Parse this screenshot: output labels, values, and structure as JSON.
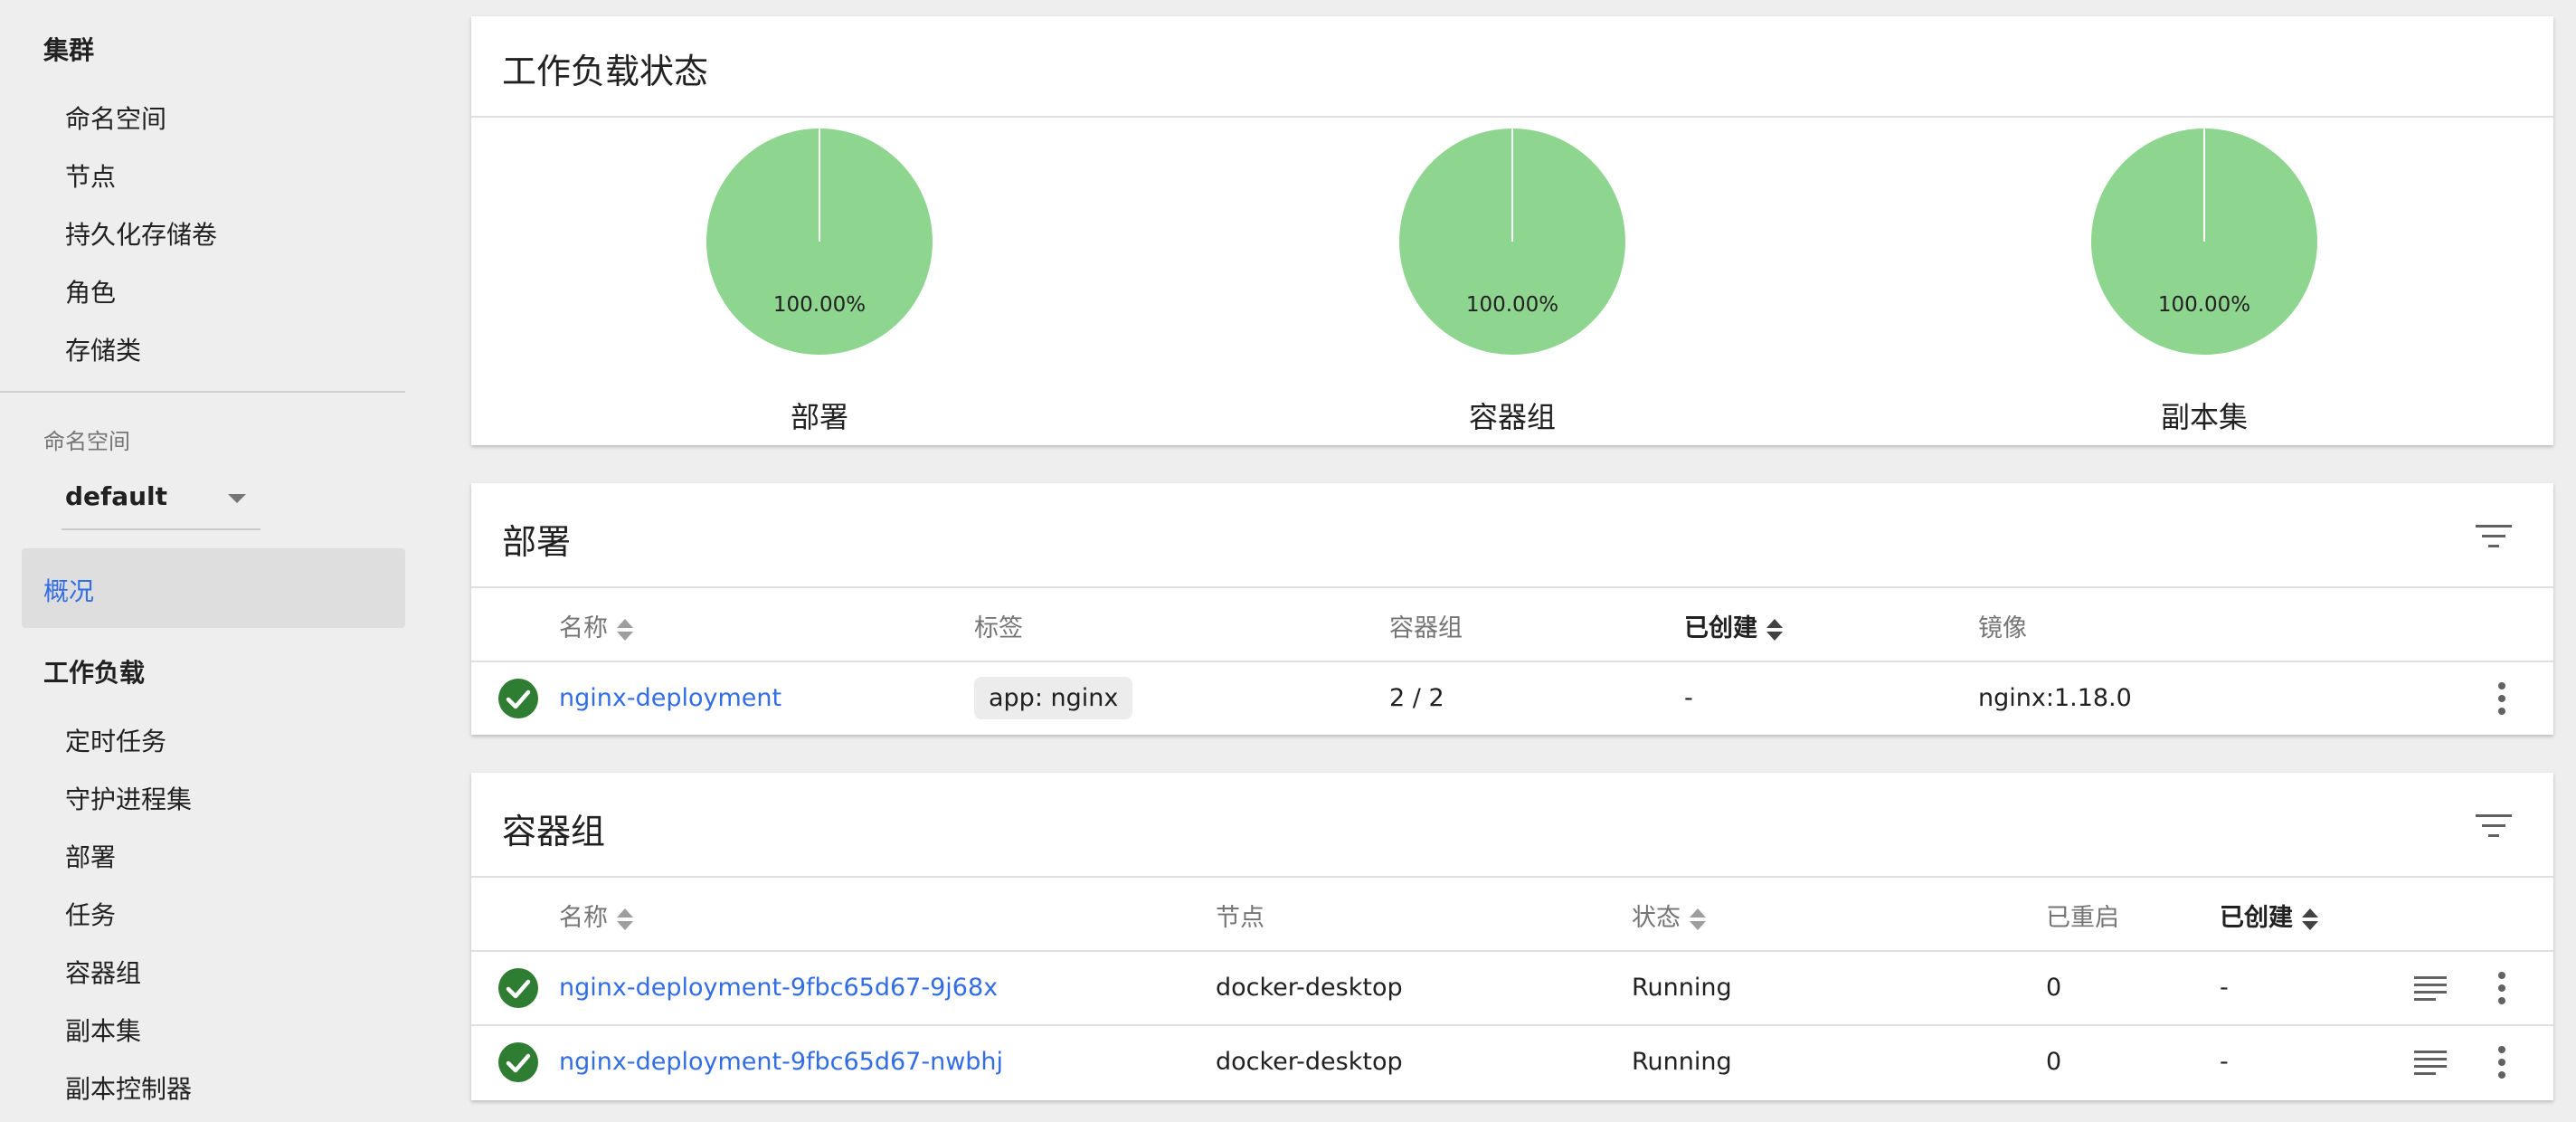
{
  "sidebar": {
    "cluster_heading": "集群",
    "cluster_items": [
      "命名空间",
      "节点",
      "持久化存储卷",
      "角色",
      "存储类"
    ],
    "namespace_caption": "命名空间",
    "namespace_value": "default",
    "overview_label": "概况",
    "workloads_heading": "工作负载",
    "workload_items": [
      "定时任务",
      "守护进程集",
      "部署",
      "任务",
      "容器组",
      "副本集",
      "副本控制器"
    ]
  },
  "workload_status": {
    "title": "工作负载状态",
    "pies": [
      {
        "label": "部署",
        "percent_text": "100.00%",
        "running_fraction": 1.0,
        "color": "#8ed58f"
      },
      {
        "label": "容器组",
        "percent_text": "100.00%",
        "running_fraction": 1.0,
        "color": "#8ed58f"
      },
      {
        "label": "副本集",
        "percent_text": "100.00%",
        "running_fraction": 1.0,
        "color": "#8ed58f"
      }
    ]
  },
  "deployments": {
    "title": "部署",
    "columns": {
      "name": "名称",
      "labels": "标签",
      "pods": "容器组",
      "created": "已创建",
      "images": "镜像"
    },
    "rows": [
      {
        "name": "nginx-deployment",
        "label": "app: nginx",
        "pods": "2 / 2",
        "created": "-",
        "image": "nginx:1.18.0"
      }
    ]
  },
  "pods": {
    "title": "容器组",
    "columns": {
      "name": "名称",
      "node": "节点",
      "status": "状态",
      "restarts": "已重启",
      "created": "已创建"
    },
    "rows": [
      {
        "name": "nginx-deployment-9fbc65d67-9j68x",
        "node": "docker-desktop",
        "status": "Running",
        "restarts": "0",
        "created": "-"
      },
      {
        "name": "nginx-deployment-9fbc65d67-nwbhj",
        "node": "docker-desktop",
        "status": "Running",
        "restarts": "0",
        "created": "-"
      }
    ]
  },
  "colors": {
    "accent": "#326de6",
    "success": "#2e7d32",
    "pie": "#8ed58f"
  }
}
